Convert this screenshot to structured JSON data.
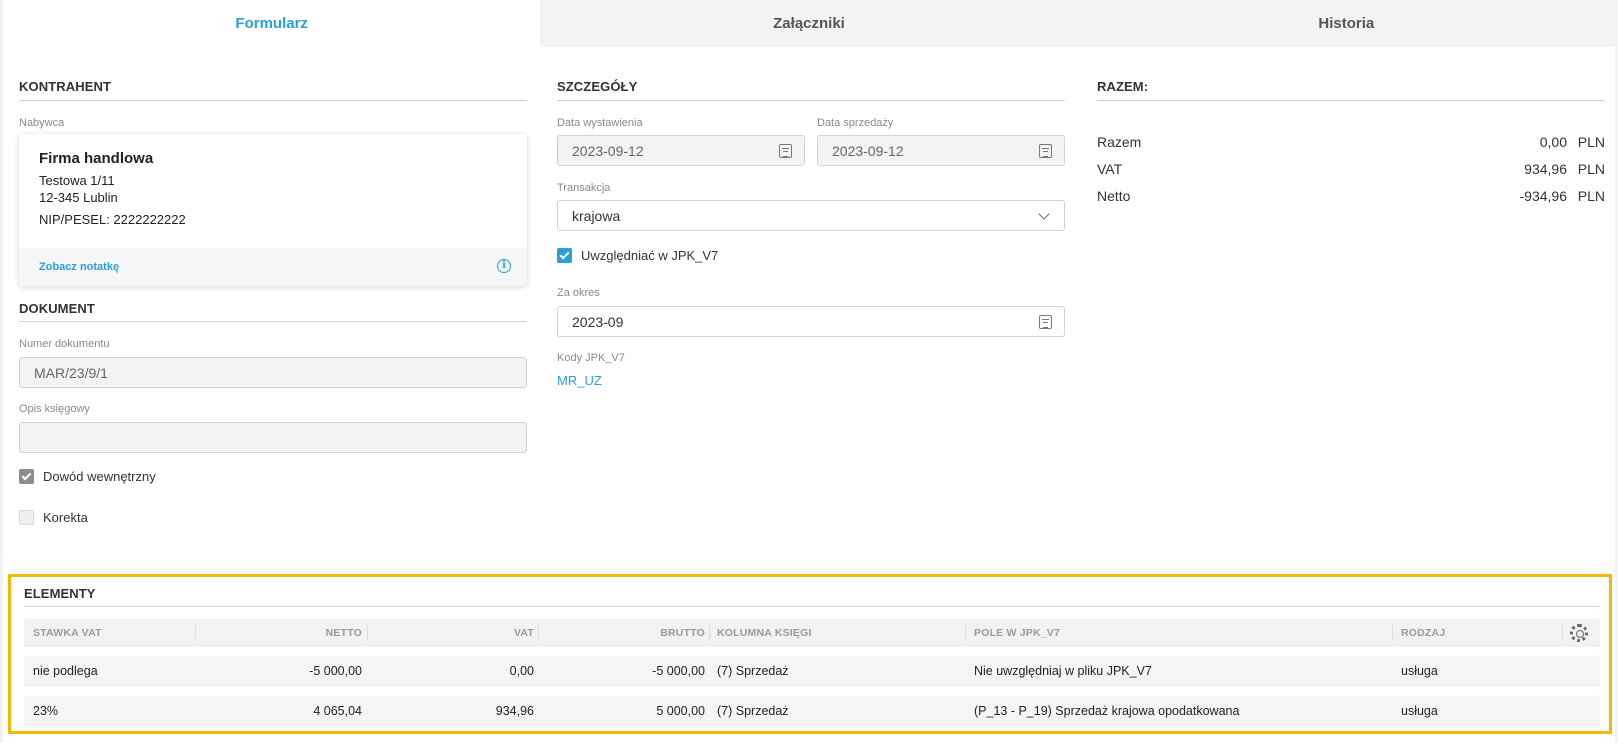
{
  "tabs": [
    "Formularz",
    "Załączniki",
    "Historia"
  ],
  "kontrahent": {
    "title": "KONTRAHENT",
    "buyer_label": "Nabywca",
    "name": "Firma handlowa",
    "address1": "Testowa 1/11",
    "address2": "12-345 Lublin",
    "nip": "NIP/PESEL: 2222222222",
    "note_link": "Zobacz notatkę"
  },
  "dokument": {
    "title": "DOKUMENT",
    "number_label": "Numer dokumentu",
    "number_value": "MAR/23/9/1",
    "desc_label": "Opis księgowy",
    "desc_value": "",
    "internal_label": "Dowód wewnętrzny",
    "internal_checked": true,
    "correction_label": "Korekta",
    "correction_checked": false
  },
  "szczegoly": {
    "title": "SZCZEGÓŁY",
    "issue_date_label": "Data wystawienia",
    "issue_date": "2023-09-12",
    "sale_date_label": "Data sprzedaży",
    "sale_date": "2023-09-12",
    "transaction_label": "Transakcja",
    "transaction_value": "krajowa",
    "jpk_label": "Uwzględniać w JPK_V7",
    "jpk_checked": true,
    "period_label": "Za okres",
    "period_value": "2023-09",
    "codes_label": "Kody JPK_V7",
    "codes_value": "MR_UZ"
  },
  "razem": {
    "title": "RAZEM:",
    "rows": [
      {
        "label": "Razem",
        "value": "0,00",
        "currency": "PLN"
      },
      {
        "label": "VAT",
        "value": "934,96",
        "currency": "PLN"
      },
      {
        "label": "Netto",
        "value": "-934,96",
        "currency": "PLN"
      }
    ]
  },
  "elements": {
    "title": "ELEMENTY",
    "columns": [
      "STAWKA VAT",
      "NETTO",
      "VAT",
      "BRUTTO",
      "KOLUMNA KSIĘGI",
      "POLE W JPK_V7",
      "RODZAJ"
    ],
    "rows": [
      [
        "nie podlega",
        "-5 000,00",
        "0,00",
        "-5 000,00",
        "(7) Sprzedaż",
        "Nie uwzględniaj w pliku JPK_V7",
        "usługa"
      ],
      [
        "23%",
        "4 065,04",
        "934,96",
        "5 000,00",
        "(7) Sprzedaż",
        "(P_13 - P_19) Sprzedaż krajowa opodatkowana",
        "usługa"
      ]
    ]
  },
  "colors": {
    "accent": "#2a9fd8",
    "highlight": "#f6b800"
  },
  "icons": [
    "calendar-icon",
    "chevron-down-icon",
    "info-icon",
    "check-icon",
    "gear-icon"
  ]
}
